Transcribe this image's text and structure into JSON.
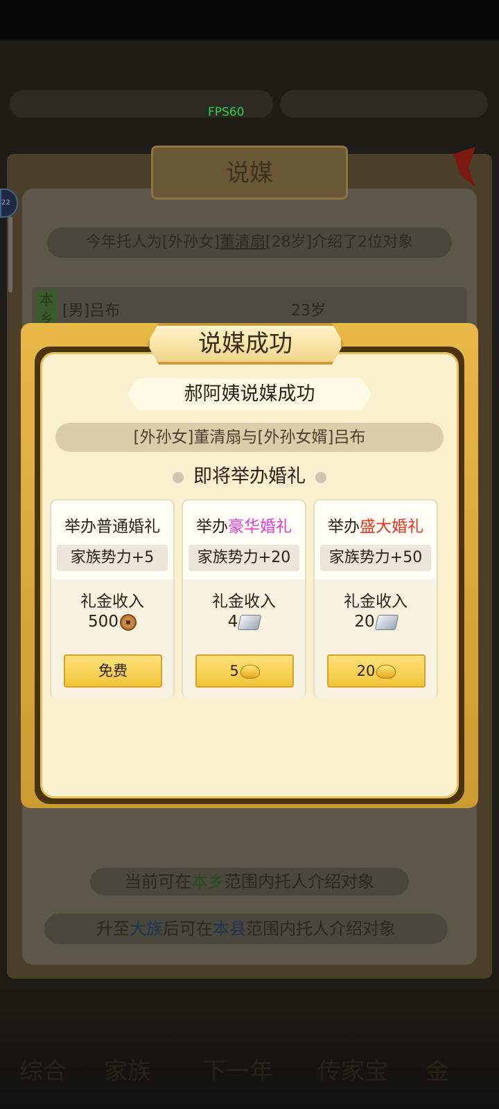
{
  "fps": "FPS60",
  "background": {
    "title": "说媒",
    "info_prefix": "今年托人为[外孙女]",
    "info_name": "董清扇",
    "info_suffix": "[28岁]介绍了2位对象",
    "tag": "本乡",
    "candidate": "[男]吕布",
    "candidate_age": "23岁",
    "hint1_a": "当前可在",
    "hint1_b": "本乡",
    "hint1_c": "范围内托人介绍对象",
    "hint2_a": "升至",
    "hint2_b": "大族",
    "hint2_c": "后可在",
    "hint2_d": "本县",
    "hint2_e": "范围内托人介绍对象",
    "nav": [
      "综合",
      "家族",
      "下一年",
      "传家宝",
      "金"
    ]
  },
  "modal": {
    "title": "说媒成功",
    "subtitle": "郝阿姨说媒成功",
    "couple": "[外孙女]董清扇与[外孙女婿]吕布",
    "upcoming": "即将举办婚礼",
    "cards": [
      {
        "head_prefix": "举办",
        "head_type": "普通婚礼",
        "type_color": "#2b2216",
        "bonus": "家族势力+5",
        "income_label": "礼金收入",
        "income_value": "500",
        "income_icon": "copper-coin-icon",
        "button": "免费",
        "button_icon": ""
      },
      {
        "head_prefix": "举办",
        "head_type": "豪华婚礼",
        "type_color": "#e23ad9",
        "bonus": "家族势力+20",
        "income_label": "礼金收入",
        "income_value": "4",
        "income_icon": "silver-ingot-icon",
        "button": "5",
        "button_icon": "gold-ingot-icon"
      },
      {
        "head_prefix": "举办",
        "head_type": "盛大婚礼",
        "type_color": "#e8341c",
        "bonus": "家族势力+50",
        "income_label": "礼金收入",
        "income_value": "20",
        "income_icon": "silver-ingot-icon",
        "button": "20",
        "button_icon": "gold-ingot-icon"
      }
    ]
  }
}
